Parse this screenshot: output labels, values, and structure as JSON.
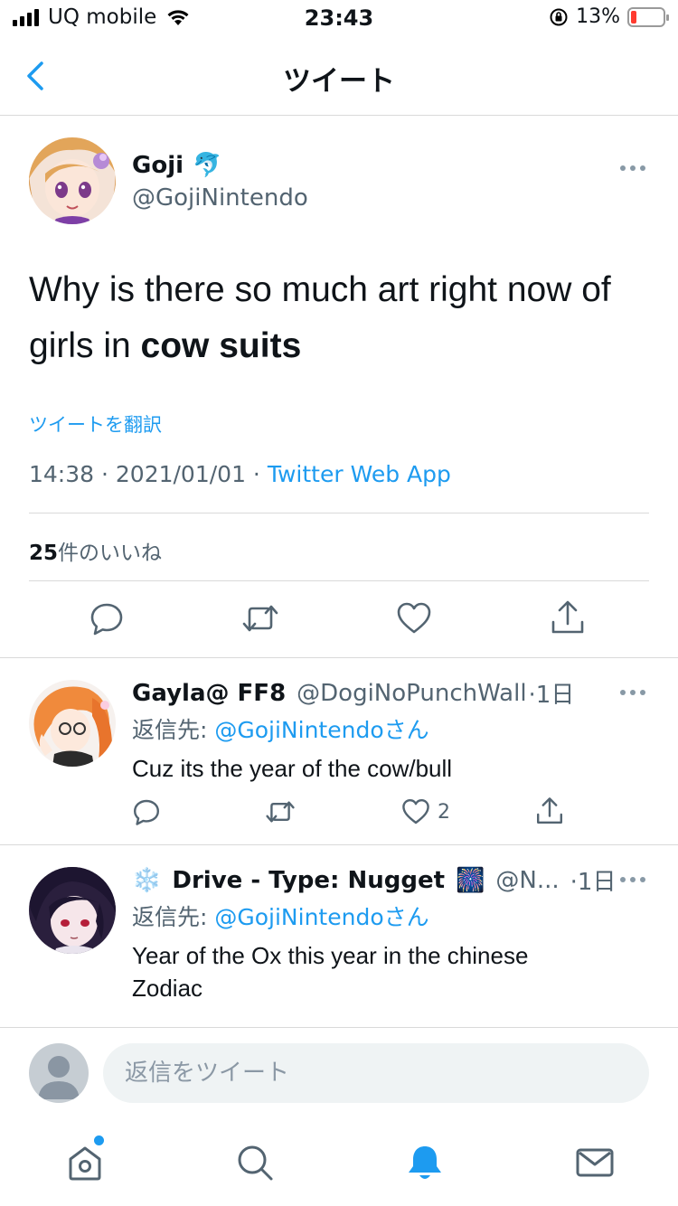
{
  "status_bar": {
    "carrier": "UQ mobile",
    "time": "23:43",
    "battery": "13%",
    "battery_level": 0.13
  },
  "nav": {
    "title": "ツイート",
    "back_icon": "chevron-left-icon"
  },
  "tweet": {
    "author_name": "Goji",
    "author_emoji": "🐬",
    "author_handle": "@GojiNintendo",
    "text_part1": "Why is there so much art right now of girls in ",
    "text_bold": "cow suits",
    "translate_label": "ツイートを翻訳",
    "timestamp": "14:38 · 2021/01/01 · ",
    "source": "Twitter Web App",
    "likes_count": "25",
    "likes_label": "件のいいね"
  },
  "replies": [
    {
      "name": "Gayla@ FF8",
      "handle": "@DogiNoPunchWall",
      "age": "·1日",
      "reply_prefix": "返信先: ",
      "reply_to": "@GojiNintendoさん",
      "text": "Cuz its the year of the cow/bull",
      "like_count": "2"
    },
    {
      "name_emoji_before": "❄️",
      "name": "Drive - Type: Nugget",
      "name_emoji_after": "🎆",
      "handle": "@N...",
      "age": "·1日",
      "reply_prefix": "返信先: ",
      "reply_to": "@GojiNintendoさん",
      "text": "Year of the Ox this year in the chinese Zodiac"
    }
  ],
  "compose": {
    "placeholder": "返信をツイート"
  },
  "tabs": [
    "home-icon",
    "search-icon",
    "notifications-icon",
    "messages-icon"
  ],
  "colors": {
    "accent": "#1d9bf0",
    "secondary_text": "#536471",
    "primary_text": "#0f1419",
    "divider": "#d9d9d9"
  }
}
